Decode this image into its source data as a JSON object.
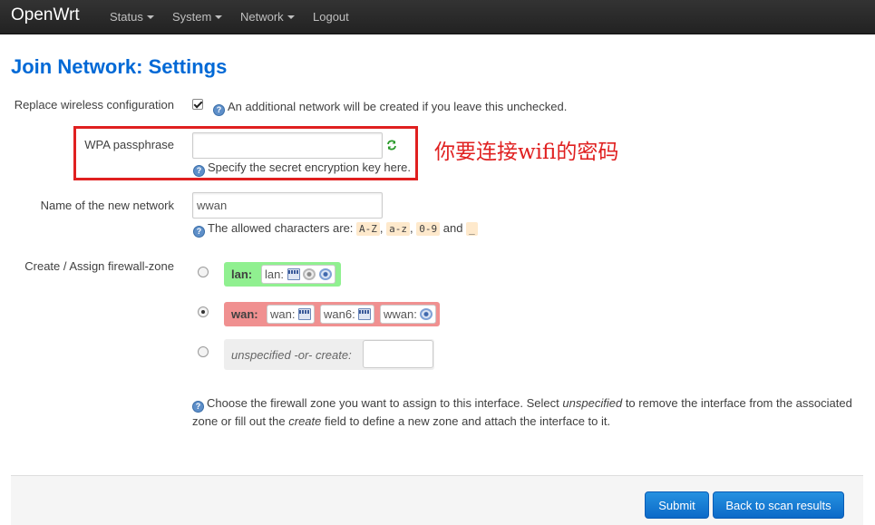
{
  "nav": {
    "brand": "OpenWrt",
    "items": [
      {
        "label": "Status",
        "dropdown": true
      },
      {
        "label": "System",
        "dropdown": true
      },
      {
        "label": "Network",
        "dropdown": true
      },
      {
        "label": "Logout",
        "dropdown": false
      }
    ]
  },
  "page": {
    "title": "Join Network: Settings"
  },
  "form": {
    "replace": {
      "label": "Replace wireless configuration",
      "checked": true,
      "help": "An additional network will be created if you leave this unchecked."
    },
    "wpa": {
      "label": "WPA passphrase",
      "value": "",
      "help": "Specify the secret encryption key here."
    },
    "network_name": {
      "label": "Name of the new network",
      "value": "wwan",
      "help_prefix": "The allowed characters are:",
      "chars": [
        "A-Z",
        "a-z",
        "0-9"
      ],
      "and": "and",
      "underscore": "_",
      "sep": ","
    },
    "firewall": {
      "label": "Create / Assign firewall-zone",
      "zones": [
        {
          "name": "lan:",
          "color": "#90f090",
          "selected": false,
          "interfaces": [
            {
              "label": "lan:",
              "icons": [
                "ethernet-port-icon",
                "wifi-disabled-icon",
                "wifi-icon"
              ]
            }
          ]
        },
        {
          "name": "wan:",
          "color": "#f09090",
          "selected": true,
          "interfaces": [
            {
              "label": "wan:",
              "icons": [
                "ethernet-port-icon"
              ]
            },
            {
              "label": "wan6:",
              "icons": [
                "ethernet-port-icon"
              ]
            },
            {
              "label": "wwan:",
              "icons": [
                "wifi-icon"
              ]
            }
          ]
        },
        {
          "name": "unspecified -or- create:",
          "selected": false,
          "create_value": ""
        }
      ],
      "help_line1_a": "Choose the firewall zone you want to assign to this interface. Select",
      "help_line1_em": "unspecified",
      "help_line1_b": "to remove the interface from the associated",
      "help_line2_a": "zone or fill out the",
      "help_line2_em": "create",
      "help_line2_b": "field to define a new zone and attach the interface to it."
    }
  },
  "annotation": "你要连接wifi的密码",
  "footer": {
    "submit": "Submit",
    "back": "Back to scan results"
  },
  "colors": {
    "navbar": "#222222",
    "title": "#0069d6",
    "annotation_red": "#e02020",
    "button": "#0c6ac8"
  }
}
